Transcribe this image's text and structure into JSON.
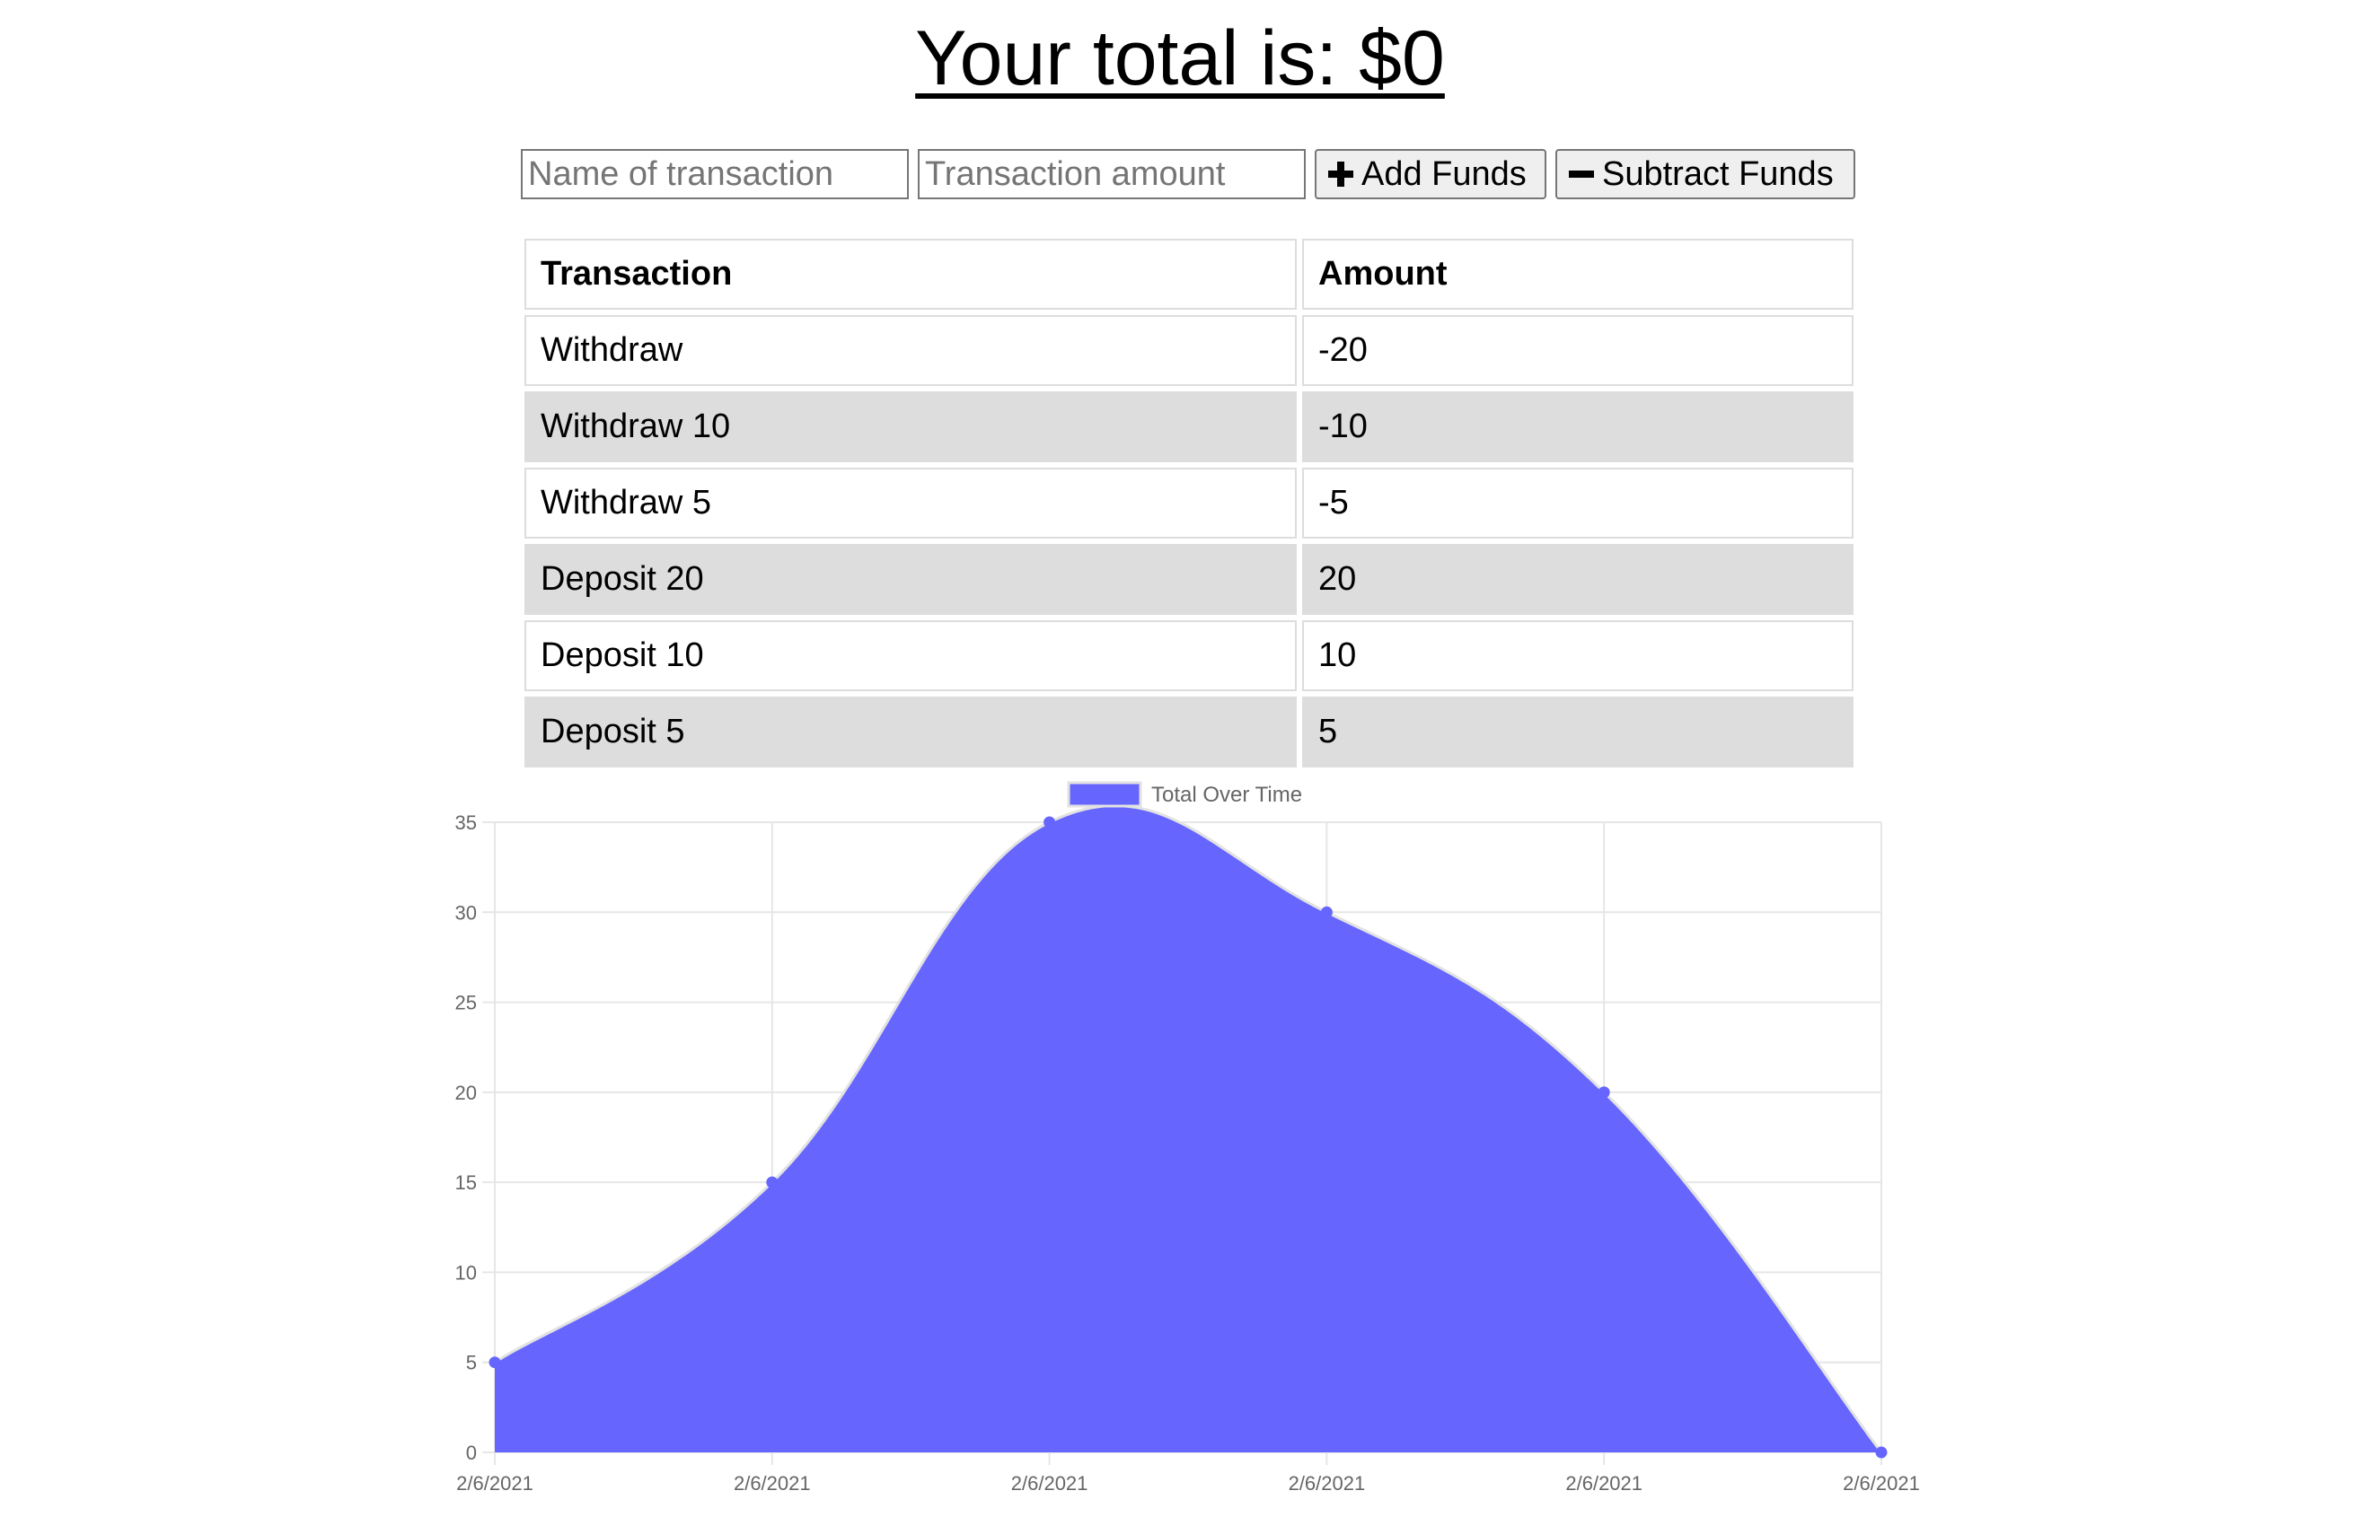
{
  "header": {
    "total_text": "Your total is: $",
    "total_value": "0"
  },
  "form": {
    "name_placeholder": "Name of transaction",
    "amount_placeholder": "Transaction amount",
    "add_label": "Add Funds",
    "subtract_label": "Subtract Funds"
  },
  "table": {
    "headers": [
      "Transaction",
      "Amount"
    ],
    "rows": [
      {
        "name": "Withdraw",
        "amount": "-20"
      },
      {
        "name": "Withdraw 10",
        "amount": "-10"
      },
      {
        "name": "Withdraw 5",
        "amount": "-5"
      },
      {
        "name": "Deposit 20",
        "amount": "20"
      },
      {
        "name": "Deposit 10",
        "amount": "10"
      },
      {
        "name": "Deposit 5",
        "amount": "5"
      }
    ]
  },
  "icons": {
    "add": "plus-icon",
    "subtract": "minus-icon"
  },
  "chart_data": {
    "type": "area",
    "x": [
      "2/6/2021",
      "2/6/2021",
      "2/6/2021",
      "2/6/2021",
      "2/6/2021",
      "2/6/2021"
    ],
    "series": [
      {
        "name": "Total Over Time",
        "values": [
          5,
          15,
          35,
          30,
          20,
          0
        ],
        "color": "#6666ff"
      }
    ],
    "ylim": [
      0,
      35
    ],
    "yticks": [
      0,
      5,
      10,
      15,
      20,
      25,
      30,
      35
    ],
    "grid": true,
    "legend": "top-center",
    "colors": {
      "fill": "#6666ff",
      "line": "#e2e2e2",
      "point": "#6666ff",
      "grid": "#e6e6e6"
    }
  }
}
